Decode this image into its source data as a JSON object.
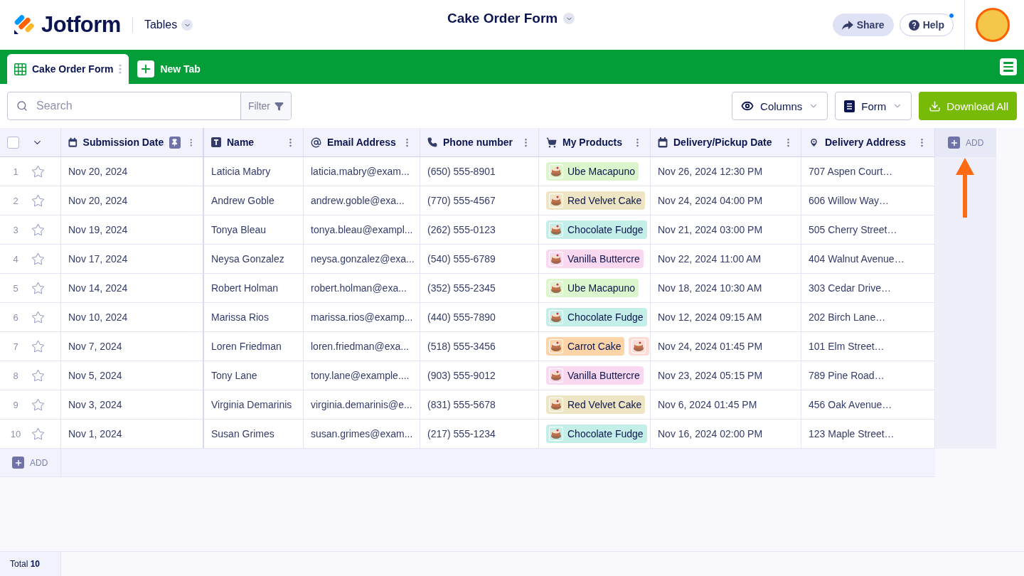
{
  "header": {
    "logo": "Jotform",
    "app_menu": "Tables",
    "title": "Cake Order Form",
    "share": "Share",
    "help": "Help"
  },
  "tabs": [
    {
      "label": "Cake Order Form",
      "selected": true
    }
  ],
  "new_tab": "New Tab",
  "toolbar": {
    "search": {
      "placeholder": "Search"
    },
    "filter": "Filter",
    "columns": "Columns",
    "form": "Form",
    "download": "Download All"
  },
  "table": {
    "select_all": {
      "checked": false
    },
    "columns": [
      {
        "label": "Submission Date",
        "kind": "date",
        "pinned": true
      },
      {
        "label": "Name",
        "kind": "text"
      },
      {
        "label": "Email Address",
        "kind": "email"
      },
      {
        "label": "Phone number",
        "kind": "phone"
      },
      {
        "label": "My Products",
        "kind": "products"
      },
      {
        "label": "Delivery/Pickup Date",
        "kind": "date"
      },
      {
        "label": "Delivery Address",
        "kind": "address"
      }
    ],
    "add_column": "ADD",
    "rows": [
      {
        "number": "1",
        "starred": false,
        "cells": [
          "Nov 20, 2024",
          "Laticia Mabry",
          "laticia.mabry@exam...",
          "(650) 555-8901",
          [
            {
              "label": "Ube Macapuno",
              "color": "#dcf5cc"
            }
          ],
          "Nov 26, 2024 12:30 PM",
          "707 Aspen Court…"
        ]
      },
      {
        "number": "2",
        "starred": false,
        "cells": [
          "Nov 20, 2024",
          "Andrew Goble",
          "andrew.goble@exa...",
          "(770) 555-4567",
          [
            {
              "label": "Red Velvet Cake",
              "color": "#ede5c4"
            }
          ],
          "Nov 24, 2024 04:00 PM",
          "606 Willow Way…"
        ]
      },
      {
        "number": "3",
        "starred": false,
        "cells": [
          "Nov 19, 2024",
          "Tonya Bleau",
          "tonya.bleau@exampl...",
          "(262) 555-0123",
          [
            {
              "label": "Chocolate Fudge",
              "color": "#c4efe8"
            }
          ],
          "Nov 21, 2024 03:00 PM",
          "505 Cherry Street…"
        ]
      },
      {
        "number": "4",
        "starred": false,
        "cells": [
          "Nov 17, 2024",
          "Neysa Gonzalez",
          "neysa.gonzalez@exa...",
          "(540) 555-6789",
          [
            {
              "label": "Vanilla Buttercre",
              "color": "#fad8f0"
            }
          ],
          "Nov 22, 2024 11:00 AM",
          "404 Walnut Avenue…"
        ]
      },
      {
        "number": "5",
        "starred": false,
        "cells": [
          "Nov 14, 2024",
          "Robert Holman",
          "robert.holman@exa...",
          "(352) 555-2345",
          [
            {
              "label": "Ube Macapuno",
              "color": "#dcf5cc"
            }
          ],
          "Nov 18, 2024 10:30 AM",
          "303 Cedar Drive…"
        ]
      },
      {
        "number": "6",
        "starred": false,
        "cells": [
          "Nov 10, 2024",
          "Marissa Rios",
          "marissa.rios@examp...",
          "(440) 555-7890",
          [
            {
              "label": "Chocolate Fudge",
              "color": "#c4efe8"
            }
          ],
          "Nov 12, 2024 09:15 AM",
          "202 Birch Lane…"
        ]
      },
      {
        "number": "7",
        "starred": false,
        "cells": [
          "Nov 7, 2024",
          "Loren Friedman",
          "loren.friedman@exa...",
          "(518) 555-3456",
          [
            {
              "label": "Carrot Cake",
              "color": "#fdd3a8"
            },
            {
              "color": "#fcdcd6"
            }
          ],
          "Nov 24, 2024 01:45 PM",
          "101 Elm Street…"
        ]
      },
      {
        "number": "8",
        "starred": false,
        "cells": [
          "Nov 5, 2024",
          "Tony Lane",
          "tony.lane@example....",
          "(903) 555-9012",
          [
            {
              "label": "Vanilla Buttercre",
              "color": "#fad8f0"
            }
          ],
          "Nov 23, 2024 05:15 PM",
          "789 Pine Road…"
        ]
      },
      {
        "number": "9",
        "starred": false,
        "cells": [
          "Nov 3, 2024",
          "Virginia Demarinis",
          "virginia.demarinis@e...",
          "(831) 555-5678",
          [
            {
              "label": "Red Velvet Cake",
              "color": "#ede5c4"
            }
          ],
          "Nov 6, 2024 01:45 PM",
          "456 Oak Avenue…"
        ]
      },
      {
        "number": "10",
        "starred": false,
        "cells": [
          "Nov 1, 2024",
          "Susan Grimes",
          "susan.grimes@exam...",
          "(217) 555-1234",
          [
            {
              "label": "Chocolate Fudge",
              "color": "#c4efe8"
            }
          ],
          "Nov 16, 2024 02:00 PM",
          "123 Maple Street…"
        ]
      }
    ],
    "add_row": "ADD"
  },
  "status_bar": {
    "total": "Total **10**"
  }
}
